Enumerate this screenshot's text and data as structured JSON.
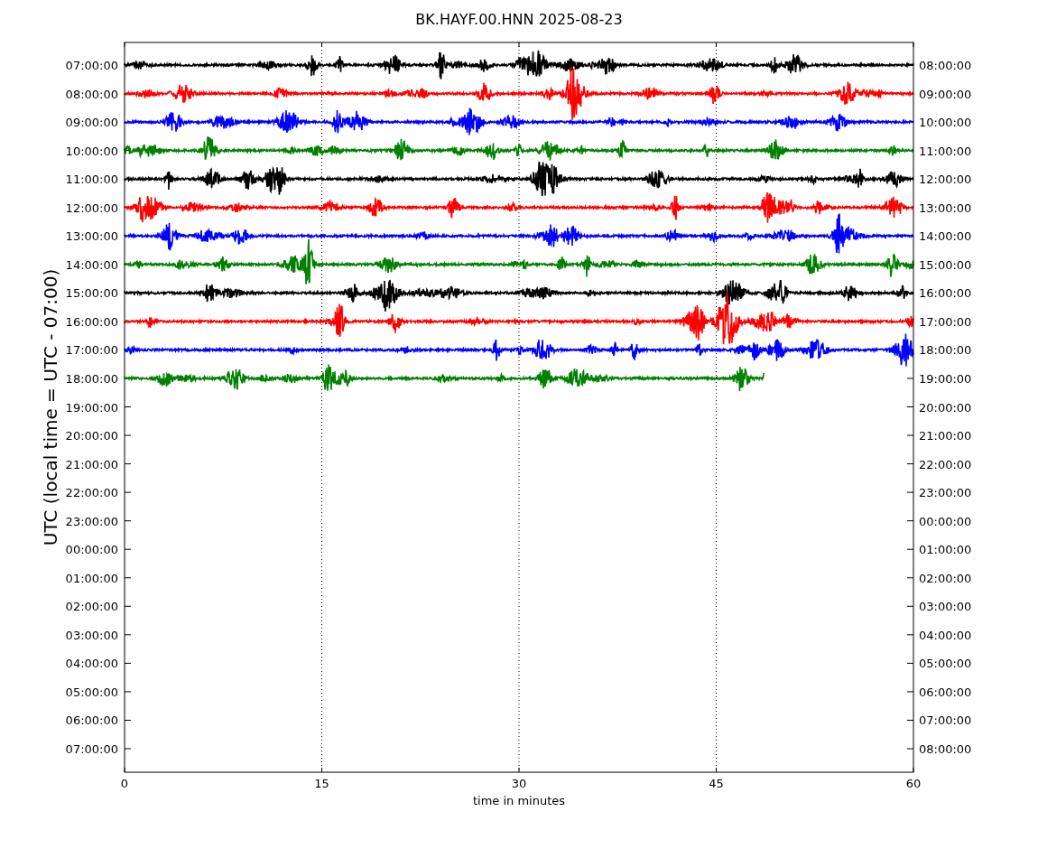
{
  "title": "BK.HAYF.00.HNN 2025-08-23",
  "ylabel": "UTC (local time = UTC - 07:00)",
  "xlabel": "time in minutes",
  "xticks": [
    "0",
    "15",
    "30",
    "45",
    "60"
  ],
  "left_ticks": [
    "07:00:00",
    "08:00:00",
    "09:00:00",
    "10:00:00",
    "11:00:00",
    "12:00:00",
    "13:00:00",
    "14:00:00",
    "15:00:00",
    "16:00:00",
    "17:00:00",
    "18:00:00",
    "19:00:00",
    "20:00:00",
    "21:00:00",
    "22:00:00",
    "23:00:00",
    "00:00:00",
    "01:00:00",
    "02:00:00",
    "03:00:00",
    "04:00:00",
    "05:00:00",
    "06:00:00",
    "07:00:00"
  ],
  "right_ticks": [
    "08:00:00",
    "09:00:00",
    "10:00:00",
    "11:00:00",
    "12:00:00",
    "13:00:00",
    "14:00:00",
    "15:00:00",
    "16:00:00",
    "17:00:00",
    "18:00:00",
    "19:00:00",
    "20:00:00",
    "21:00:00",
    "22:00:00",
    "23:00:00",
    "00:00:00",
    "01:00:00",
    "02:00:00",
    "03:00:00",
    "04:00:00",
    "05:00:00",
    "06:00:00",
    "07:00:00",
    "08:00:00"
  ],
  "traces": [
    {
      "color": "#000000",
      "level": 1
    },
    {
      "color": "#ff0000",
      "level": 1
    },
    {
      "color": "#0000ff",
      "level": 1
    },
    {
      "color": "#008000",
      "level": 1
    },
    {
      "color": "#000000",
      "level": 1
    },
    {
      "color": "#ff0000",
      "level": 1
    },
    {
      "color": "#0000ff",
      "level": 1
    },
    {
      "color": "#008000",
      "level": 1
    },
    {
      "color": "#000000",
      "level": 1
    },
    {
      "color": "#ff0000",
      "level": 1
    },
    {
      "color": "#0000ff",
      "level": 1
    },
    {
      "color": "#008000",
      "level": 0.81
    }
  ]
}
